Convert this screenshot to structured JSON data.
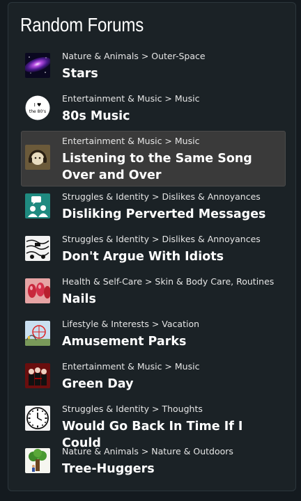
{
  "title": "Random Forums",
  "forums": [
    {
      "category": "Nature & Animals > Outer-Space",
      "name": "Stars",
      "icon": "galaxy-icon"
    },
    {
      "category": "Entertainment & Music > Music",
      "name": "80s Music",
      "icon": "i-love-80s-icon"
    },
    {
      "category": "Entertainment & Music > Music",
      "name": "Listening to the Same Song Over and Over",
      "icon": "headphones-icon"
    },
    {
      "category": "Struggles & Identity > Dislikes & Annoyances",
      "name": "Disliking Perverted Messages",
      "icon": "chat-people-icon"
    },
    {
      "category": "Struggles & Identity > Dislikes & Annoyances",
      "name": "Don't Argue With Idiots",
      "icon": "sketch-icon"
    },
    {
      "category": "Health & Self-Care > Skin & Body Care, Routines",
      "name": "Nails",
      "icon": "nails-icon"
    },
    {
      "category": "Lifestyle & Interests > Vacation",
      "name": "Amusement Parks",
      "icon": "amusement-park-icon"
    },
    {
      "category": "Entertainment & Music > Music",
      "name": "Green Day",
      "icon": "band-icon"
    },
    {
      "category": "Struggles & Identity > Thoughts",
      "name": "Would Go Back In Time If I Could",
      "icon": "clock-icon"
    },
    {
      "category": "Nature & Animals > Nature & Outdoors",
      "name": "Tree-Huggers",
      "icon": "tree-icon"
    }
  ],
  "thumb_80s_text": {
    "line1": "I ♥",
    "line2": "the 80's"
  },
  "colors": {
    "background": "#141a1f",
    "panel": "#1b2226",
    "active_row": "#3a3a3a"
  }
}
